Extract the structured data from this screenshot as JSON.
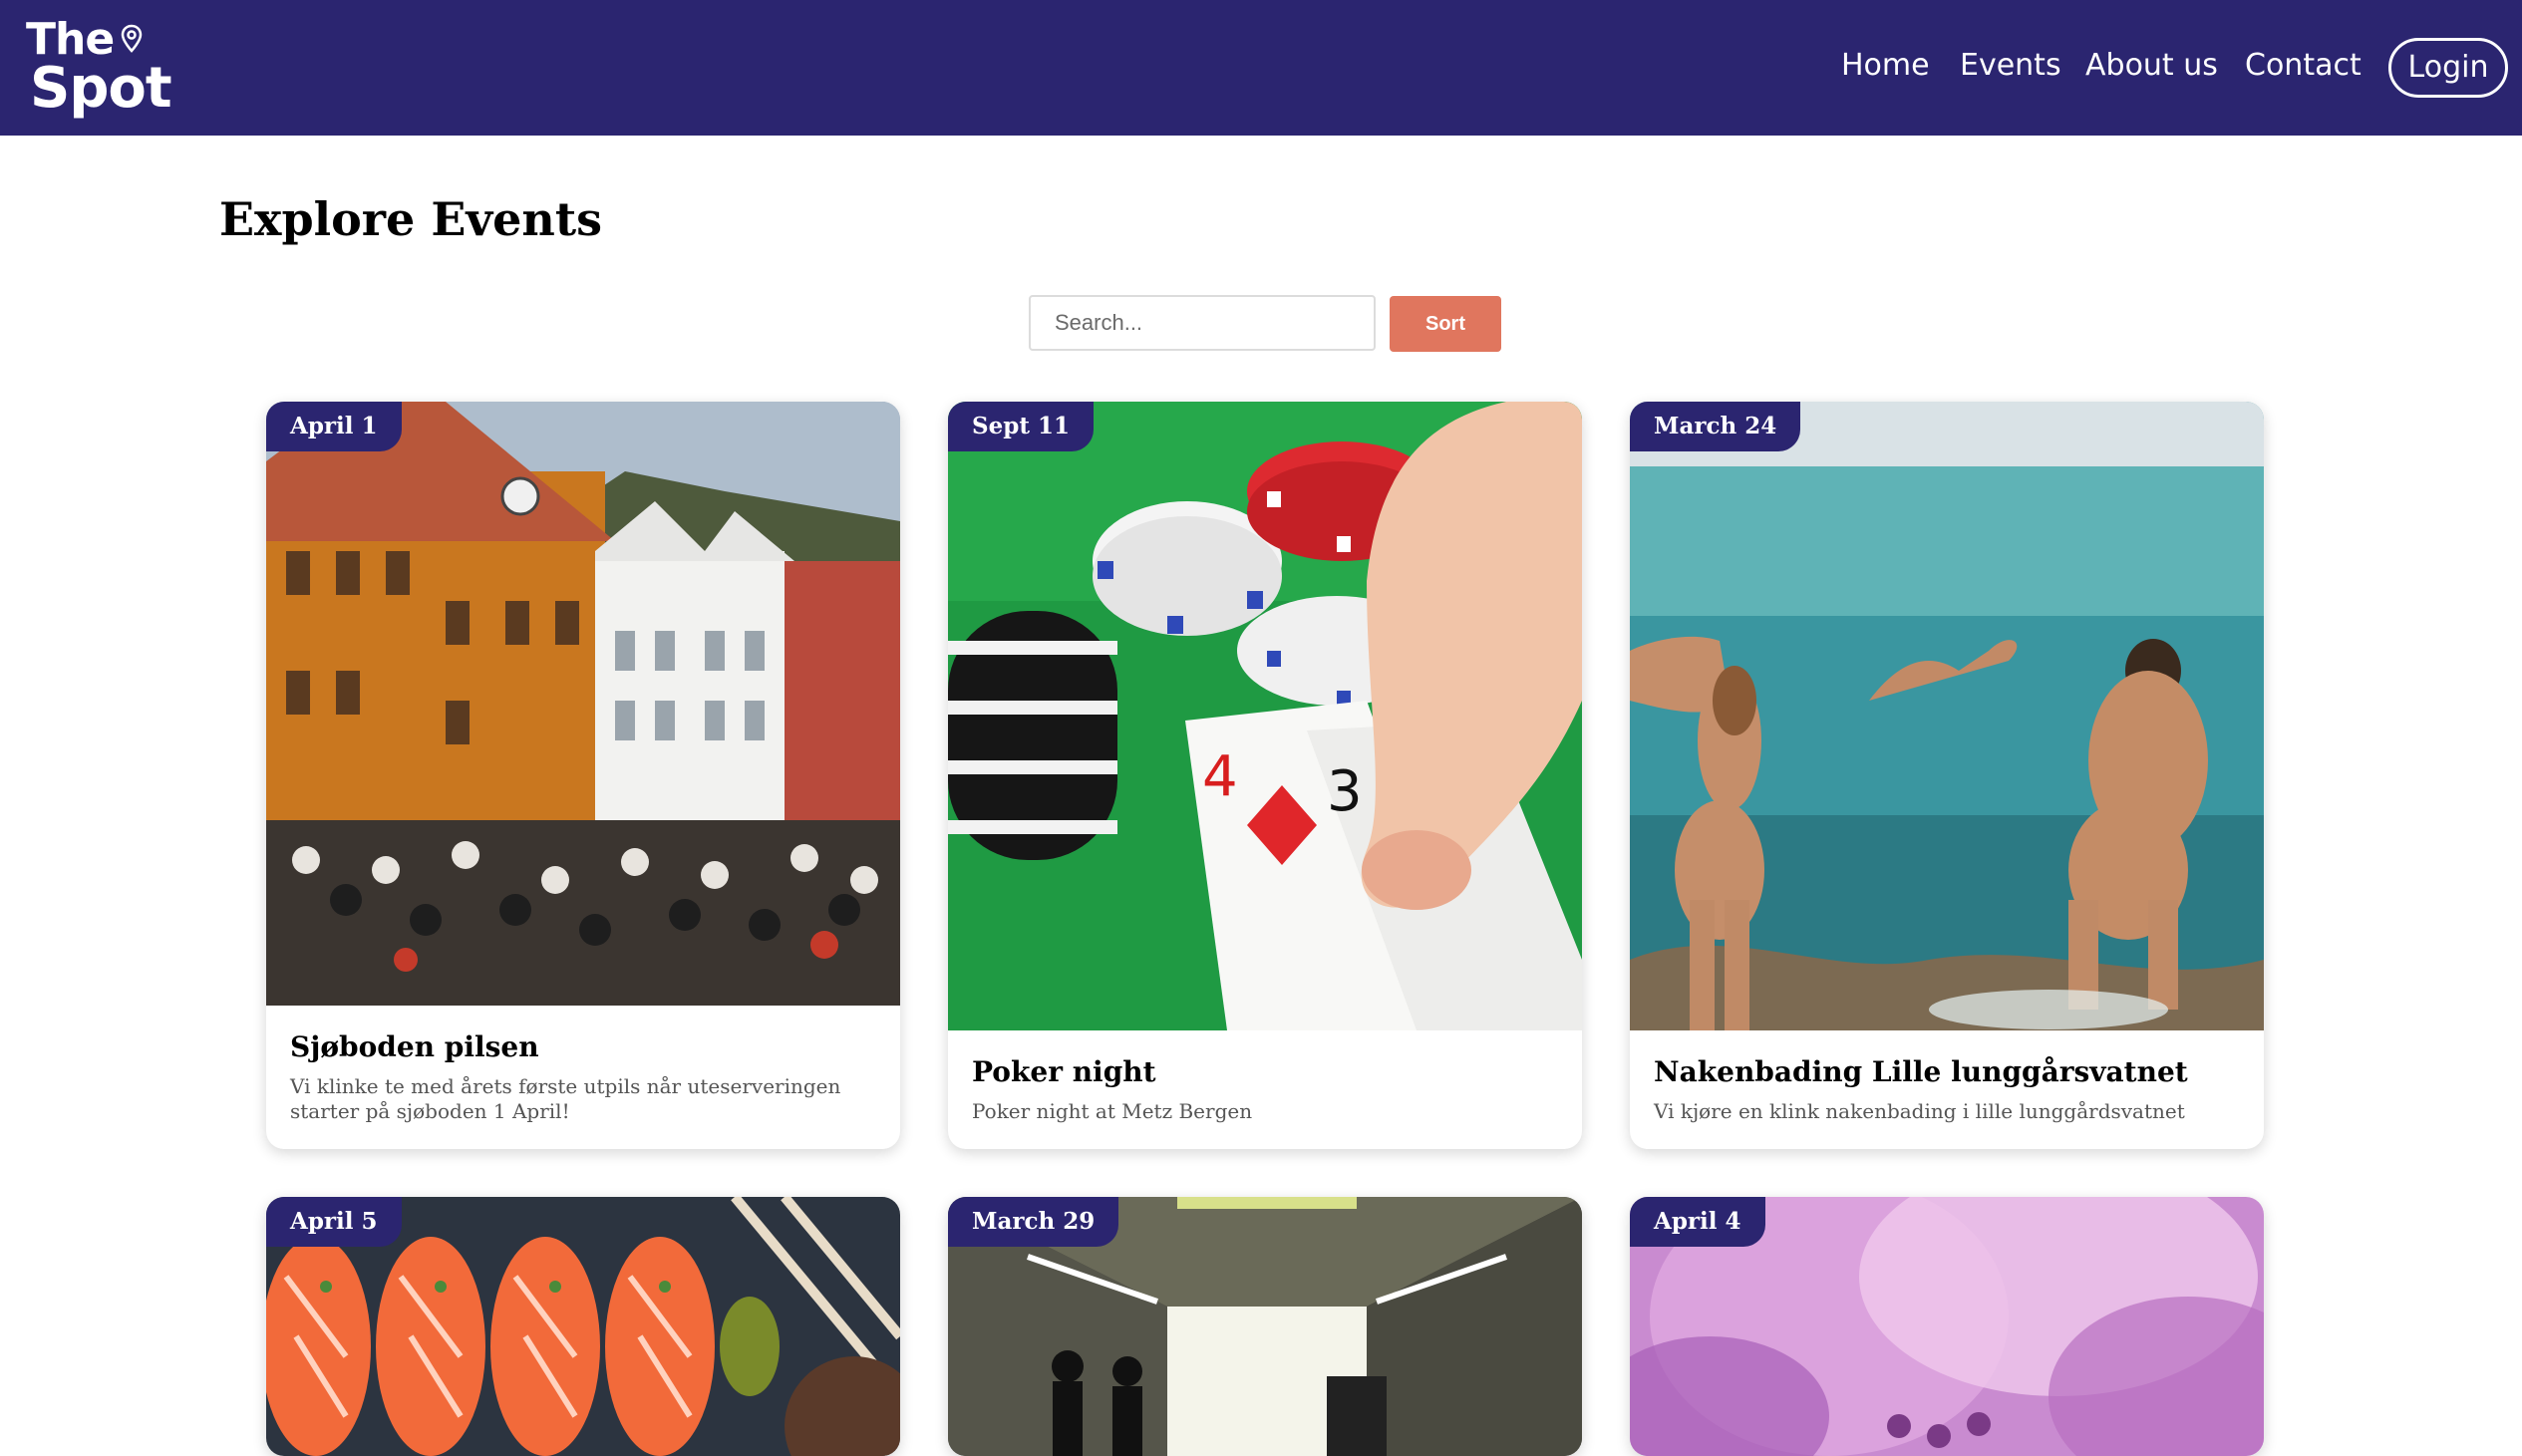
{
  "header": {
    "logo_top": "The",
    "logo_bottom": "Spot",
    "logo_icon": "map-pin-icon",
    "nav": [
      "Home",
      "Events",
      "About us",
      "Contact"
    ],
    "login_label": "Login",
    "bg_color": "#2b2570"
  },
  "main": {
    "title": "Explore Events",
    "search": {
      "placeholder": "Search...",
      "value": ""
    },
    "sort_label": "Sort",
    "accent_color": "#e0765e",
    "events": [
      {
        "date": "April 1",
        "title": "Sjøboden pilsen",
        "description": "Vi klinke te med årets første utpils når uteserveringen starter på sjøboden 1 April!",
        "image": "bryggen-outdoor-crowd"
      },
      {
        "date": "Sept 11",
        "title": "Poker night",
        "description": "Poker night at Metz Bergen",
        "image": "poker-chips-and-cards"
      },
      {
        "date": "March 24",
        "title": "Nakenbading Lille lunggårsvatnet",
        "description": "Vi kjøre en klink nakenbading i lille lunggårdsvatnet",
        "image": "people-wading-into-sea"
      },
      {
        "date": "April 5",
        "title": "",
        "description": "",
        "image": "salmon-sushi"
      },
      {
        "date": "March 29",
        "title": "",
        "description": "",
        "image": "tunnel-silhouettes"
      },
      {
        "date": "April 4",
        "title": "",
        "description": "",
        "image": "pink-smoke-crowd"
      }
    ]
  }
}
